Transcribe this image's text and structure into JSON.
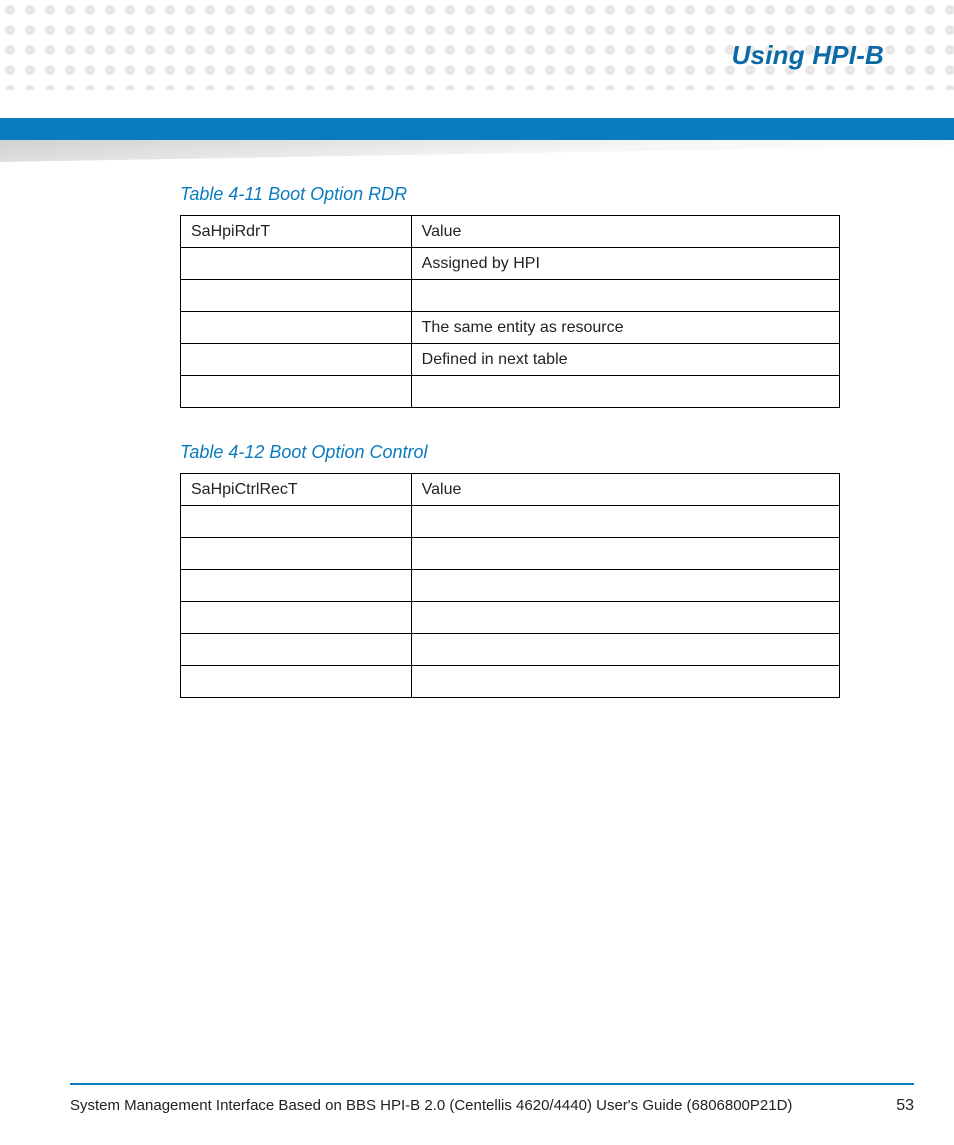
{
  "header": {
    "chapter_title": "Using HPI-B"
  },
  "tables": {
    "t1": {
      "caption": "Table 4-11 Boot Option RDR",
      "rows": [
        {
          "c1": "SaHpiRdrT",
          "c2": "Value"
        },
        {
          "c1": "",
          "c2": "Assigned by HPI"
        },
        {
          "c1": "",
          "c2": ""
        },
        {
          "c1": "",
          "c2": "The same entity as resource"
        },
        {
          "c1": "",
          "c2": "Defined in next table"
        },
        {
          "c1": "",
          "c2": ""
        }
      ]
    },
    "t2": {
      "caption": "Table 4-12 Boot Option Control",
      "rows": [
        {
          "c1": "SaHpiCtrlRecT",
          "c2": "Value"
        },
        {
          "c1": "",
          "c2": ""
        },
        {
          "c1": "",
          "c2": ""
        },
        {
          "c1": "",
          "c2": ""
        },
        {
          "c1": "",
          "c2": ""
        },
        {
          "c1": "",
          "c2": ""
        },
        {
          "c1": "",
          "c2": ""
        }
      ]
    }
  },
  "footer": {
    "text": "System Management Interface Based on BBS HPI-B 2.0 (Centellis 4620/4440) User's Guide (6806800P21D)",
    "page": "53"
  }
}
